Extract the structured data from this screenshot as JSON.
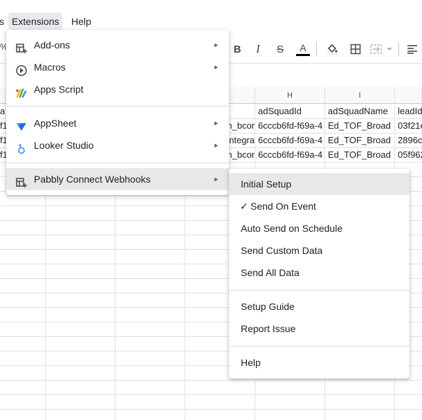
{
  "menubar": {
    "items": [
      {
        "label": "s"
      },
      {
        "label": "Extensions"
      },
      {
        "label": "Help"
      }
    ]
  },
  "toolbar": {
    "percent_label": "%",
    "items": [
      "bold-icon",
      "italic-icon",
      "strikethrough-icon",
      "text-color-icon",
      "fill-color-icon",
      "borders-icon",
      "merge-cells-icon",
      "align-left-icon"
    ]
  },
  "grid": {
    "columns": [
      {
        "label": ""
      },
      {
        "label": ""
      },
      {
        "label": ""
      },
      {
        "label": ""
      },
      {
        "label": "H"
      },
      {
        "label": "I"
      },
      {
        "label": ""
      }
    ],
    "left_edge_cells": [
      "a",
      "f1",
      "f1",
      "f1"
    ],
    "row1": {
      "g": "",
      "h": "adSquadId",
      "i": "adSquadName",
      "j": "leadId"
    },
    "rows": [
      {
        "g": "n_bcor",
        "h": "6cccb6fd-f69a-4",
        "i": "Ed_TOF_Broad",
        "j": "03f21e"
      },
      {
        "g": "_integra",
        "h": "6cccb6fd-f69a-4",
        "i": "Ed_TOF_Broad",
        "j": "2896c"
      },
      {
        "g": "n_bcor",
        "h": "6cccb6fd-f69a-4",
        "i": "Ed_TOF_Broad",
        "j": "05f962"
      }
    ]
  },
  "extensions_menu": {
    "items": [
      {
        "label": "Add-ons",
        "icon": "add-ons-icon",
        "has_submenu": true
      },
      {
        "label": "Macros",
        "icon": "macros-icon",
        "has_submenu": true
      },
      {
        "label": "Apps Script",
        "icon": "apps-script-icon",
        "has_submenu": false
      },
      {
        "label": "AppSheet",
        "icon": "appsheet-icon",
        "has_submenu": true
      },
      {
        "label": "Looker Studio",
        "icon": "looker-studio-icon",
        "has_submenu": true
      },
      {
        "label": "Pabbly Connect Webhooks",
        "icon": "pabbly-icon",
        "has_submenu": true
      }
    ],
    "arrow": "►"
  },
  "pabbly_submenu": {
    "items": [
      {
        "label": "Initial Setup",
        "checked": false
      },
      {
        "label": "Send On Event",
        "checked": true
      },
      {
        "label": "Auto Send on Schedule",
        "checked": false
      },
      {
        "label": "Send Custom Data",
        "checked": false
      },
      {
        "label": "Send All Data",
        "checked": false
      },
      {
        "label": "Setup Guide",
        "checked": false
      },
      {
        "label": "Report Issue",
        "checked": false
      },
      {
        "label": "Help",
        "checked": false
      }
    ],
    "check_mark": "✓"
  },
  "colors": {
    "highlight": "#e8e8e8",
    "apps_script_blue": "#4285f4",
    "appsheet_blue": "#1a73e8",
    "looker_blue": "#4285f4"
  }
}
